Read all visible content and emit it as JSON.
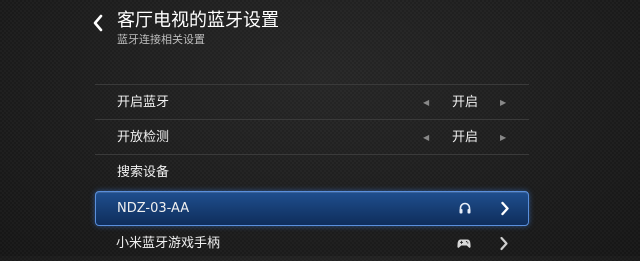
{
  "header": {
    "title": "客厅电视的蓝牙设置",
    "subtitle": "蓝牙连接相关设置"
  },
  "settings": {
    "bluetooth": {
      "label": "开启蓝牙",
      "value": "开启"
    },
    "discovery": {
      "label": "开放检测",
      "value": "开启"
    },
    "search": {
      "label": "搜索设备"
    }
  },
  "devices": [
    {
      "name": "NDZ-03-AA",
      "icon": "headphones-icon",
      "selected": true
    },
    {
      "name": "小米蓝牙游戏手柄",
      "icon": "gamepad-icon",
      "selected": false
    }
  ],
  "colors": {
    "background": "#1c1c1c",
    "selection": "#1f4f8f",
    "selection_border": "#5a8fdc",
    "divider": "#3a3a3a"
  }
}
